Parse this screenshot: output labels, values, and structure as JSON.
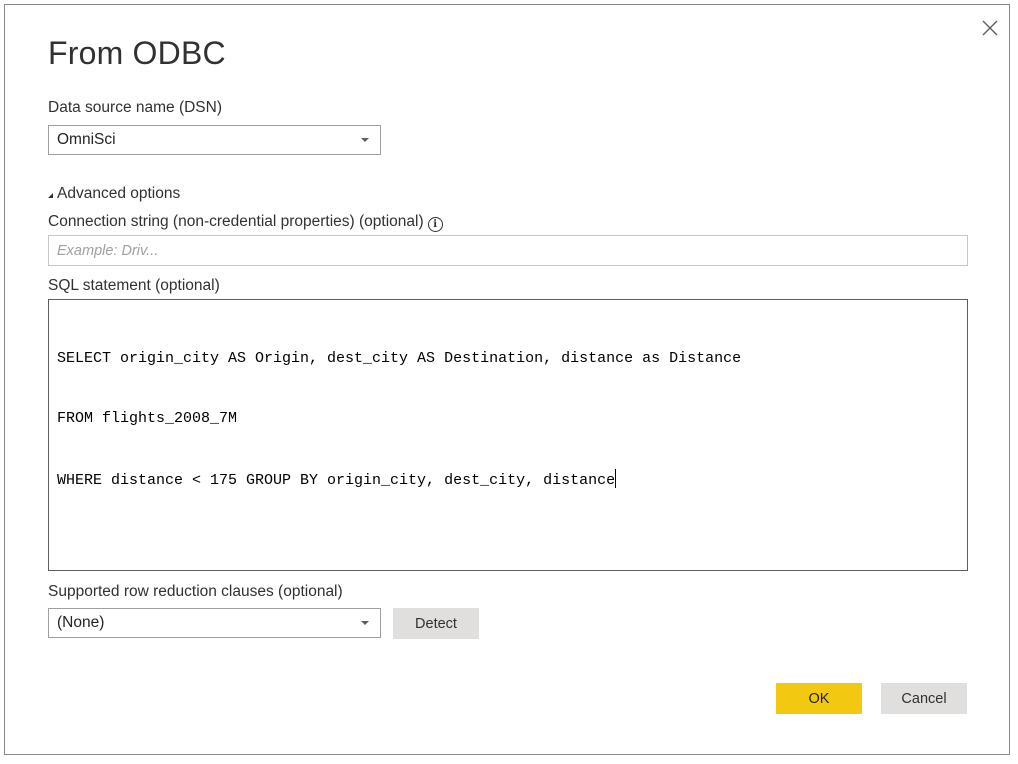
{
  "dialog": {
    "title": "From ODBC",
    "close_icon": "close-icon"
  },
  "dsn": {
    "label": "Data source name (DSN)",
    "selected": "OmniSci"
  },
  "advanced": {
    "toggle_label": "Advanced options",
    "expanded": true
  },
  "connection_string": {
    "label": "Connection string (non-credential properties) (optional)",
    "info_icon": "info-icon",
    "value": "",
    "placeholder": "Example: Driv..."
  },
  "sql": {
    "label": "SQL statement (optional)",
    "lines": [
      "SELECT origin_city AS Origin, dest_city AS Destination, distance as Distance",
      "FROM flights_2008_7M",
      "WHERE distance < 175 GROUP BY origin_city, dest_city, distance"
    ]
  },
  "row_reduction": {
    "label": "Supported row reduction clauses (optional)",
    "selected": "(None)",
    "detect_label": "Detect"
  },
  "footer": {
    "ok_label": "OK",
    "cancel_label": "Cancel"
  },
  "colors": {
    "primary_button": "#f2c811",
    "secondary_button": "#e1dfdd"
  }
}
